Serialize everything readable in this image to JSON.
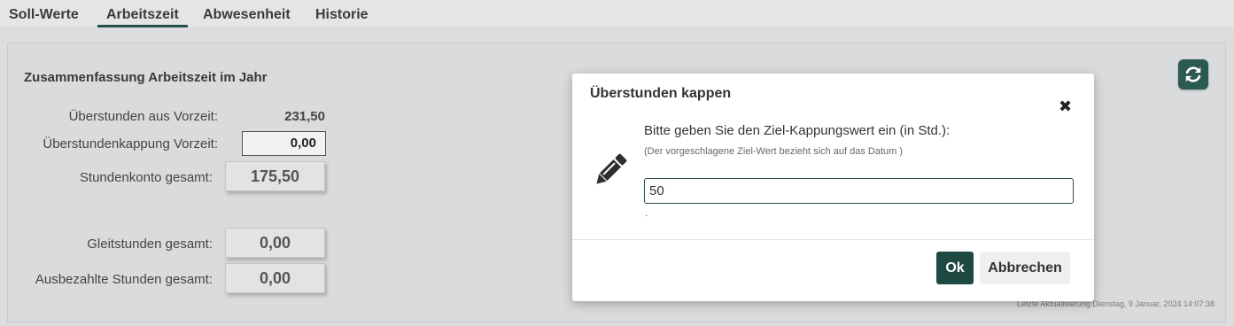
{
  "tabs": [
    {
      "label": "Soll-Werte",
      "active": false
    },
    {
      "label": "Arbeitszeit",
      "active": true
    },
    {
      "label": "Abwesenheit",
      "active": false
    },
    {
      "label": "Historie",
      "active": false
    }
  ],
  "panel": {
    "title": "Zusammenfassung Arbeitszeit im Jahr",
    "rows": {
      "ueberstunden_vorzeit": {
        "label": "Überstunden aus Vorzeit:",
        "value": "231,50"
      },
      "kappung_vorzeit": {
        "label": "Überstundenkappung Vorzeit:",
        "value": "0,00"
      },
      "stundenkonto": {
        "label": "Stundenkonto gesamt:",
        "value": "175,50"
      },
      "gleitstunden": {
        "label": "Gleitstunden gesamt:",
        "value": "0,00"
      },
      "ausbezahlt": {
        "label": "Ausbezahlte Stunden gesamt:",
        "value": "0,00"
      }
    },
    "refresh_icon": "refresh-icon",
    "timestamp": "Letzte Aktualisierung:Dienstag, 9 Januar, 2024 14:07:38"
  },
  "modal": {
    "title": "Überstunden kappen",
    "close_icon": "close-icon",
    "pencil_icon": "pencil-icon",
    "prompt": "Bitte geben Sie den Ziel-Kappungswert ein (in Std.):",
    "hint": "(Der vorgeschlagene Ziel-Wert bezieht sich auf das Datum )",
    "input_value": "50",
    "error_text": ".",
    "ok_label": "Ok",
    "cancel_label": "Abbrechen"
  },
  "colors": {
    "accent": "#24514a",
    "ok_button": "#1e4a41",
    "background": "#dcdddf"
  }
}
